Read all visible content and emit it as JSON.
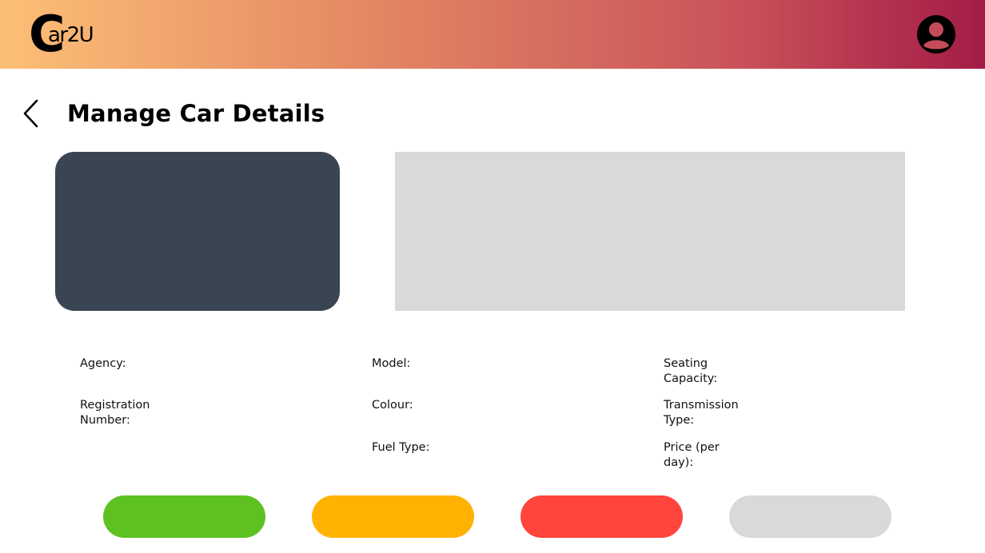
{
  "header": {
    "logo_text": "Car2U",
    "logo_c": "C",
    "logo_rest": "ar2U",
    "avatar_icon": "account-circle-icon",
    "gradient_colors": [
      "#fdbf76",
      "#e58b64",
      "#c9525a",
      "#a31c46"
    ]
  },
  "page": {
    "back_icon": "chevron-left-icon",
    "title": "Manage Car Details"
  },
  "fields": {
    "agency": "Agency:",
    "registration": "Registration Number:",
    "model": "Model:",
    "colour": "Colour:",
    "fuel_type": "Fuel Type:",
    "seating": "Seating Capacity:",
    "transmission": "Transmission Type:",
    "price": "Price (per day):"
  },
  "buttons": {
    "colors": [
      "#5ec122",
      "#ffb300",
      "#ff453c",
      "#d9d9d9"
    ]
  },
  "colors": {
    "car_image_placeholder": "#394553",
    "info_panel": "#d9d9d9"
  }
}
